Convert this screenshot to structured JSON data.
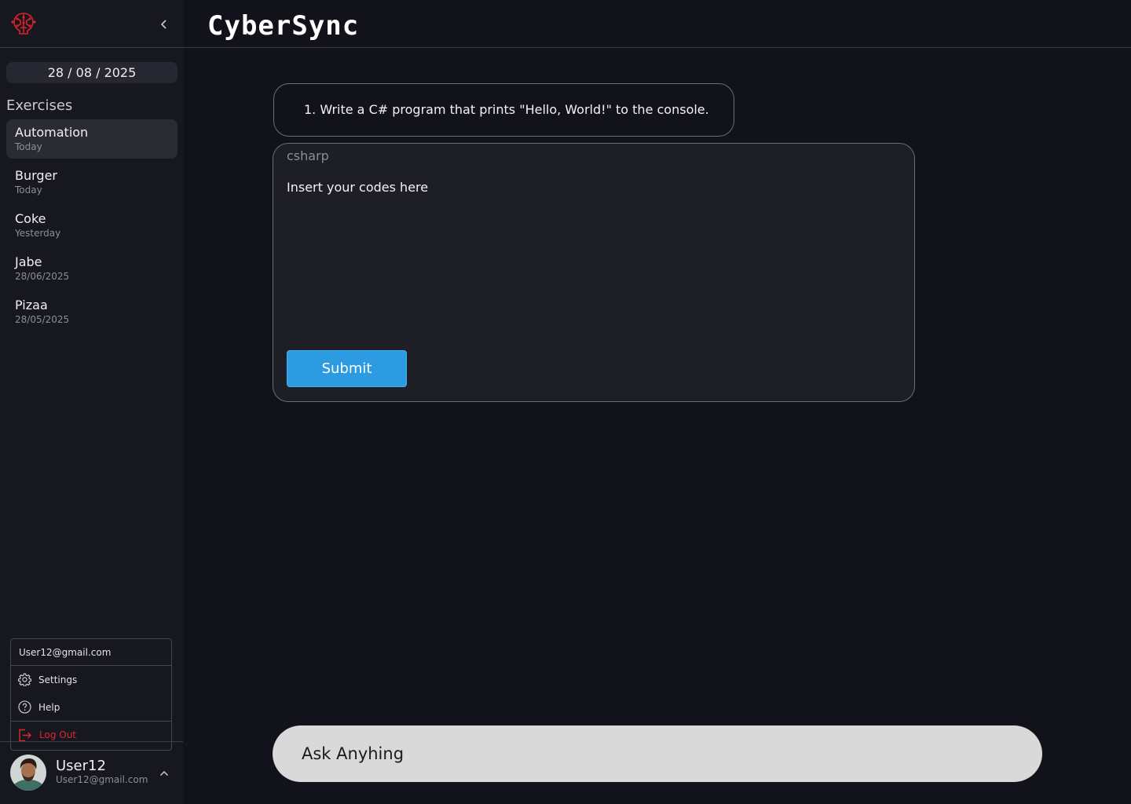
{
  "app": {
    "brand": "CyberSync"
  },
  "sidebar": {
    "date": "28 / 08 / 2025",
    "exercises_title": "Exercises",
    "exercises": [
      {
        "name": "Automation",
        "date": "Today",
        "active": true
      },
      {
        "name": "Burger",
        "date": "Today"
      },
      {
        "name": "Coke",
        "date": "Yesterday"
      },
      {
        "name": "Jabe",
        "date": "28/06/2025"
      },
      {
        "name": "Pizaa",
        "date": "28/05/2025"
      }
    ],
    "icons": {
      "logo": "circuit-brain-logo",
      "collapse": "chevron-left-icon",
      "expand": "chevron-up-icon"
    }
  },
  "account_menu": {
    "email": "User12@gmail.com",
    "items": [
      {
        "label": "Settings",
        "icon": "gear-icon"
      },
      {
        "label": "Help",
        "icon": "help-circle-icon"
      },
      {
        "label": "Log Out",
        "icon": "logout-icon",
        "color": "#e0262e"
      }
    ]
  },
  "user": {
    "name": "User12",
    "email": "User12@gmail.com"
  },
  "main": {
    "question": "1. Write a C# program that prints \"Hello, World!\" to the console.",
    "code_editor": {
      "language": "csharp",
      "placeholder": "Insert your codes here"
    },
    "submit_label": "Submit",
    "ask_placeholder": "Ask Anyhing"
  },
  "colors": {
    "background": "#12131a",
    "sidebar": "#16171f",
    "accent": "#2c9be2",
    "danger": "#e0262e",
    "ask_bar": "#d9d9d9"
  }
}
